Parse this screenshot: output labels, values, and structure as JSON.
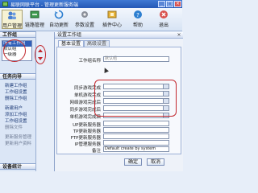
{
  "window": {
    "title": "易联网联平台 - 管理更新服务端",
    "minimize": "_",
    "maximize": "□",
    "close": "×"
  },
  "toolbar": {
    "items": [
      {
        "label": "用户管理",
        "icon": "users-icon"
      },
      {
        "label": "链路管理",
        "icon": "link-icon"
      },
      {
        "label": "自动更新",
        "icon": "refresh-icon"
      },
      {
        "label": "参数设置",
        "icon": "gear-icon"
      },
      {
        "label": "插件中心",
        "icon": "plugin-icon"
      },
      {
        "label": "帮助",
        "icon": "help-icon"
      },
      {
        "label": "退出",
        "icon": "exit-icon"
      }
    ]
  },
  "left_panel": {
    "groups_title": "工作组",
    "groups": [
      "所有工作组",
      "默认组",
      "一级器"
    ],
    "tasks_title": "任务向导",
    "tasks": [
      "新建工作组",
      "工作组设置",
      "删除工作组",
      "新建用户",
      "添加工作组",
      "工作组设置",
      "删除文件",
      "更新服务管理",
      "更新用户资料"
    ],
    "device_title": "设备统计"
  },
  "dialog": {
    "title": "设置工作组",
    "close": "×",
    "tabs": [
      "基本设置",
      "高级设置"
    ],
    "fields": [
      {
        "label": "工作组名称",
        "value": "默认组"
      },
      {
        "label": "同步游戏完成",
        "value": ""
      },
      {
        "label": "单机游戏完成",
        "value": ""
      },
      {
        "label": "网络游戏完成后",
        "value": ""
      },
      {
        "label": "同步游戏完成后",
        "value": ""
      },
      {
        "label": "单机游戏完成后",
        "value": ""
      },
      {
        "label": "UP更新服务器",
        "value": ""
      },
      {
        "label": "TP更新服务器",
        "value": ""
      },
      {
        "label": "FTP更新服务器",
        "value": ""
      },
      {
        "label": "IP管理服务器",
        "value": ""
      },
      {
        "label": "备注",
        "value": "Default create by system"
      }
    ],
    "ok": "确定",
    "cancel": "取消"
  },
  "colors": {
    "accent": "#2458b6",
    "highlight": "#c2272d"
  }
}
